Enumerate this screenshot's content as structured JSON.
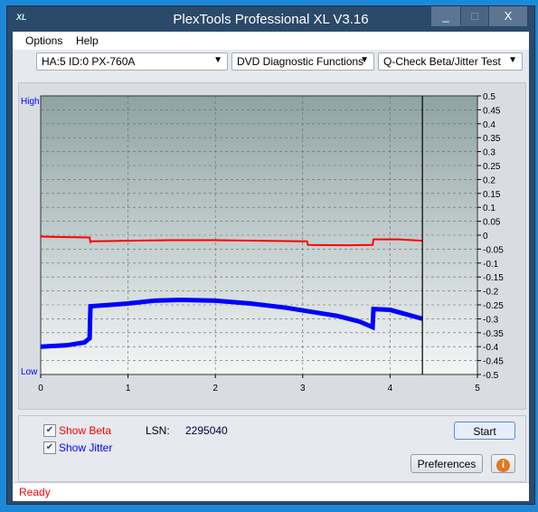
{
  "window": {
    "title": "PlexTools Professional XL V3.16",
    "logo": "XL",
    "minimize": "_",
    "maximize": "□",
    "close": "X"
  },
  "menu": {
    "items": [
      "Options",
      "Help"
    ]
  },
  "toolbar": {
    "drive": "HA:5 ID:0  PX-760A",
    "function": "DVD Diagnostic Functions",
    "test": "Q-Check Beta/Jitter Test"
  },
  "chart_data": {
    "type": "line",
    "xlim": [
      0,
      5
    ],
    "ylim": [
      -0.5,
      0.5
    ],
    "x_ticks": [
      "0",
      "1",
      "2",
      "3",
      "4",
      "5"
    ],
    "y_ticks": [
      "0.5",
      "0.45",
      "0.4",
      "0.35",
      "0.3",
      "0.25",
      "0.2",
      "0.15",
      "0.1",
      "0.05",
      "0",
      "-0.05",
      "-0.1",
      "-0.15",
      "-0.2",
      "-0.25",
      "-0.3",
      "-0.35",
      "-0.4",
      "-0.45",
      "-0.5"
    ],
    "left_labels": {
      "high": "High",
      "low": "Low"
    },
    "grid": true,
    "marker_x": 4.37,
    "series": [
      {
        "name": "Beta",
        "color": "#ff0000",
        "points": [
          [
            0,
            -0.005
          ],
          [
            0.3,
            -0.007
          ],
          [
            0.56,
            -0.008
          ],
          [
            0.57,
            -0.025
          ],
          [
            0.58,
            -0.022
          ],
          [
            1.0,
            -0.02
          ],
          [
            1.5,
            -0.018
          ],
          [
            2.0,
            -0.018
          ],
          [
            2.5,
            -0.02
          ],
          [
            3.0,
            -0.022
          ],
          [
            3.05,
            -0.022
          ],
          [
            3.06,
            -0.035
          ],
          [
            3.5,
            -0.036
          ],
          [
            3.8,
            -0.035
          ],
          [
            3.81,
            -0.015
          ],
          [
            4.1,
            -0.015
          ],
          [
            4.37,
            -0.02
          ]
        ]
      },
      {
        "name": "Jitter",
        "color": "#0000ff",
        "points": [
          [
            0,
            -0.4
          ],
          [
            0.3,
            -0.395
          ],
          [
            0.5,
            -0.385
          ],
          [
            0.56,
            -0.37
          ],
          [
            0.57,
            -0.255
          ],
          [
            0.8,
            -0.25
          ],
          [
            1.0,
            -0.245
          ],
          [
            1.3,
            -0.235
          ],
          [
            1.6,
            -0.232
          ],
          [
            2.0,
            -0.235
          ],
          [
            2.4,
            -0.245
          ],
          [
            2.8,
            -0.26
          ],
          [
            3.1,
            -0.275
          ],
          [
            3.4,
            -0.29
          ],
          [
            3.65,
            -0.31
          ],
          [
            3.8,
            -0.33
          ],
          [
            3.81,
            -0.265
          ],
          [
            4.0,
            -0.268
          ],
          [
            4.2,
            -0.285
          ],
          [
            4.37,
            -0.3
          ]
        ]
      }
    ]
  },
  "controls": {
    "show_beta": "Show Beta",
    "show_jitter": "Show Jitter",
    "lsn_label": "LSN:",
    "lsn_value": "2295040",
    "start": "Start",
    "preferences": "Preferences",
    "info": "i"
  },
  "status": "Ready"
}
